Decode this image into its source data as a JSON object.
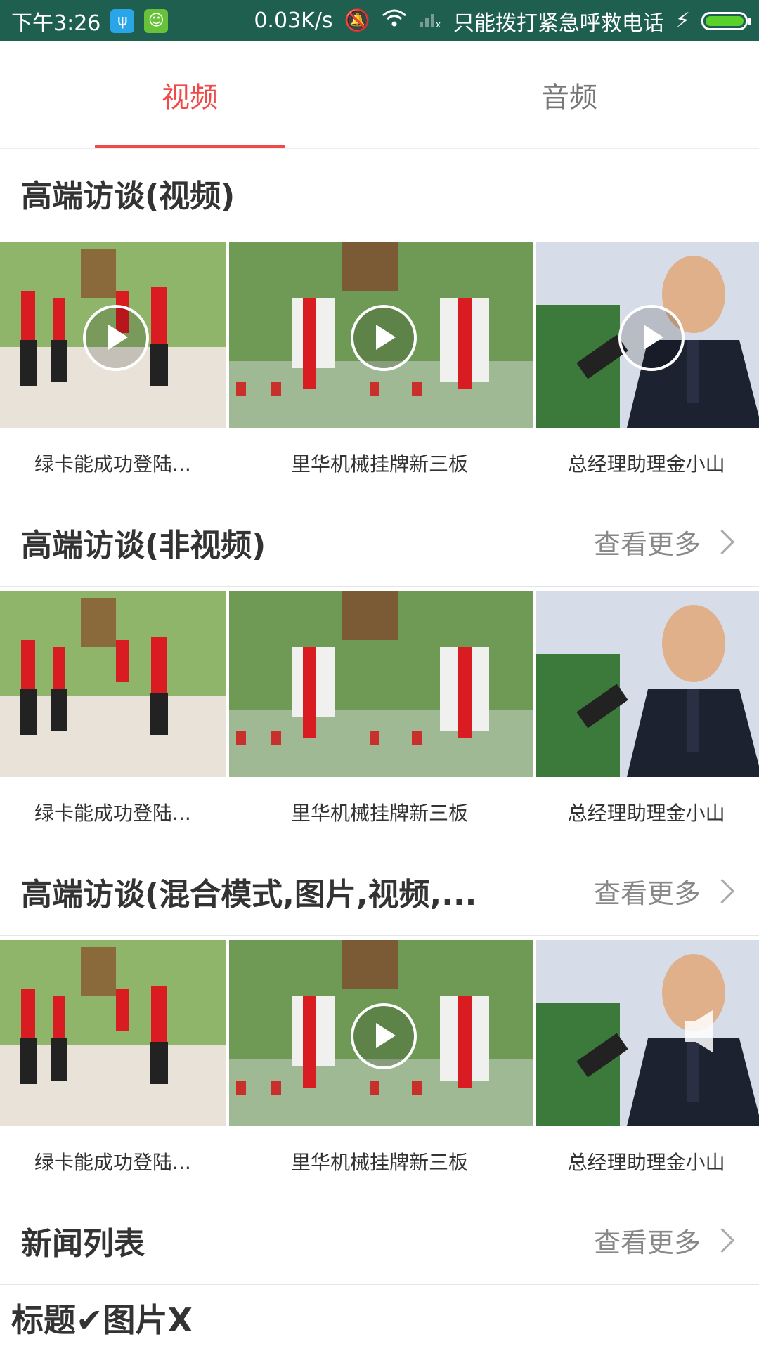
{
  "status_bar": {
    "time": "下午3:26",
    "speed": "0.03K/s",
    "carrier": "只能拨打紧急呼救电话",
    "battery_level": 1.0
  },
  "tabs": [
    {
      "label": "视频",
      "active": true
    },
    {
      "label": "音频",
      "active": false
    }
  ],
  "sections": [
    {
      "title": "高端访谈(视频)",
      "more_label": "",
      "items": [
        {
          "caption": "绿卡能成功登陆...",
          "media": "video"
        },
        {
          "caption": "里华机械挂牌新三板",
          "media": "video"
        },
        {
          "caption": "总经理助理金小山",
          "media": "video"
        }
      ]
    },
    {
      "title": "高端访谈(非视频)",
      "more_label": "查看更多",
      "items": [
        {
          "caption": "绿卡能成功登陆...",
          "media": "image"
        },
        {
          "caption": "里华机械挂牌新三板",
          "media": "image"
        },
        {
          "caption": "总经理助理金小山",
          "media": "image"
        }
      ]
    },
    {
      "title": "高端访谈(混合模式,图片,视频,...",
      "more_label": "查看更多",
      "items": [
        {
          "caption": "绿卡能成功登陆...",
          "media": "image"
        },
        {
          "caption": "里华机械挂牌新三板",
          "media": "video"
        },
        {
          "caption": "总经理助理金小山",
          "media": "audio"
        }
      ]
    },
    {
      "title": "新闻列表",
      "more_label": "查看更多"
    }
  ],
  "bottom_title": "标题✔图片X",
  "colors": {
    "status_bar": "#1f5f4f",
    "accent": "#f04a48",
    "text": "#333333",
    "muted": "#888888"
  },
  "icons": [
    "usb-icon",
    "android-icon",
    "mute-bell-icon",
    "wifi-icon",
    "signal-icon",
    "charging-icon",
    "battery-icon",
    "play-icon",
    "chevron-right-icon",
    "speaker-icon"
  ]
}
